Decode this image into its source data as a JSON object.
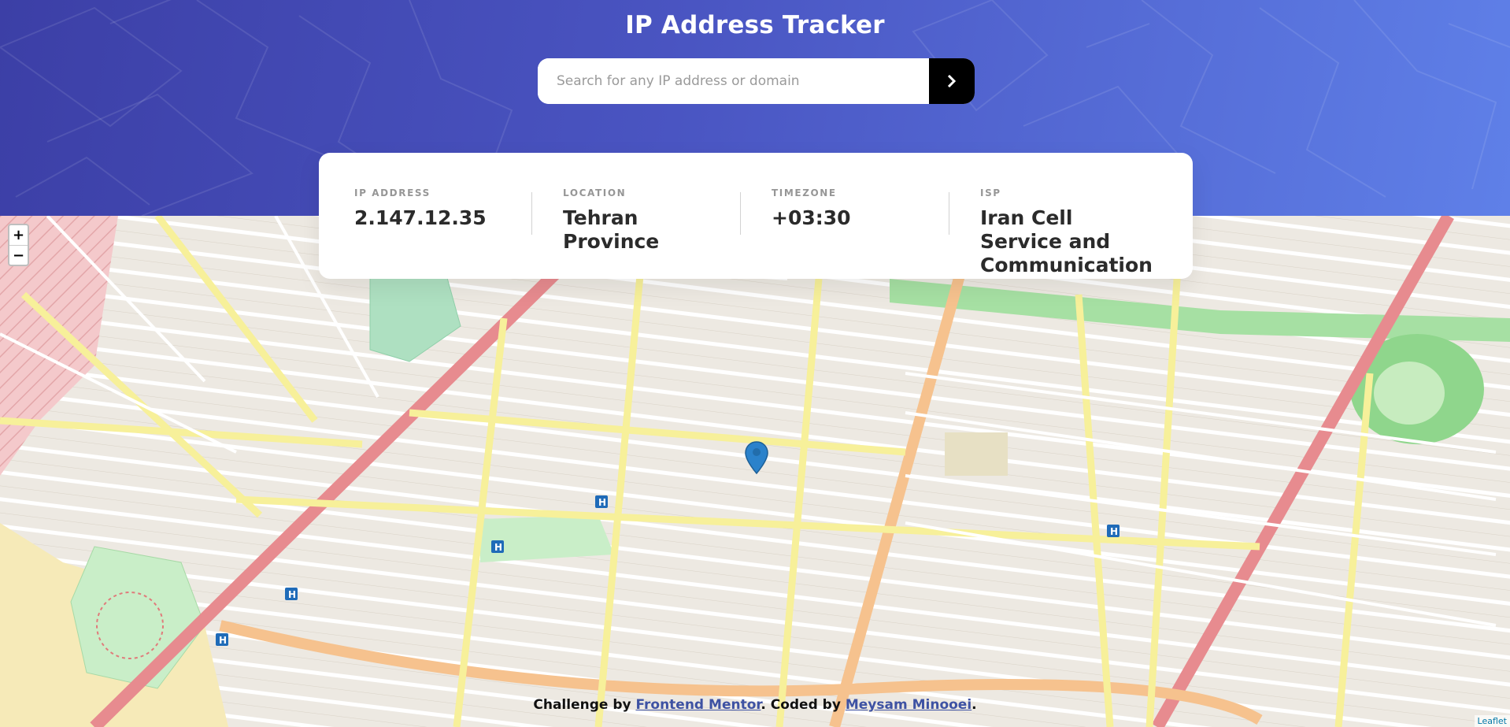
{
  "header": {
    "title": "IP Address Tracker",
    "search_placeholder": "Search for any IP address or domain",
    "search_value": ""
  },
  "info": {
    "ip_label": "IP ADDRESS",
    "ip_value": "2.147.12.35",
    "location_label": "LOCATION",
    "location_value": "Tehran Province",
    "timezone_label": "TIMEZONE",
    "timezone_value": "+03:30",
    "isp_label": "ISP",
    "isp_value": "Iran Cell Service and Communication"
  },
  "map": {
    "zoom_in": "+",
    "zoom_out": "−",
    "attribution": "Leaflet"
  },
  "footer": {
    "prefix": "Challenge by ",
    "link1": "Frontend Mentor",
    "middle": ". Coded by ",
    "link2": "Meysam Minooei",
    "suffix": "."
  },
  "colors": {
    "accent": "#4a55c2",
    "text_dark": "#2b2b2b",
    "label_gray": "#969696"
  }
}
